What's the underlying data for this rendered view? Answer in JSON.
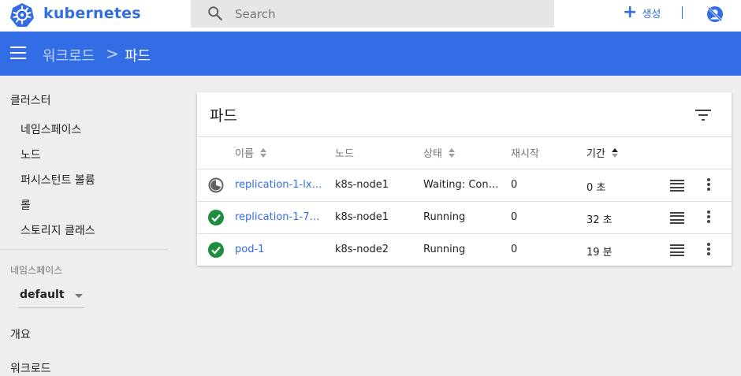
{
  "brand": {
    "name": "kubernetes"
  },
  "search": {
    "placeholder": "Search",
    "value": ""
  },
  "header": {
    "create_label": "생성"
  },
  "appbar": {
    "breadcrumb_parent": "워크로드",
    "breadcrumb_separator": ">",
    "breadcrumb_current": "파드"
  },
  "sidebar": {
    "cluster_title": "클러스터",
    "cluster_items": [
      "네임스페이스",
      "노드",
      "퍼시스턴트 볼륨",
      "롤",
      "스토리지 클래스"
    ],
    "namespace_label": "네임스페이스",
    "namespace_selected": "default",
    "overview": "개요",
    "workloads": "워크로드"
  },
  "card": {
    "title": "파드",
    "columns": [
      "이름",
      "노드",
      "상태",
      "재시작",
      "기간"
    ],
    "rows": [
      {
        "name": "replication-1-lxf...",
        "node": "k8s-node1",
        "status": "Waiting: Cont...",
        "restarts": "0",
        "age": "0 초",
        "status_icon": "pending-icon"
      },
      {
        "name": "replication-1-78...",
        "node": "k8s-node1",
        "status": "Running",
        "restarts": "0",
        "age": "32 초",
        "status_icon": "check-circle-icon"
      },
      {
        "name": "pod-1",
        "node": "k8s-node2",
        "status": "Running",
        "restarts": "0",
        "age": "19 분",
        "status_icon": "check-circle-icon"
      }
    ]
  },
  "colors": {
    "accent": "#326de6",
    "success": "#1e8e3e",
    "pending": "#616161"
  }
}
